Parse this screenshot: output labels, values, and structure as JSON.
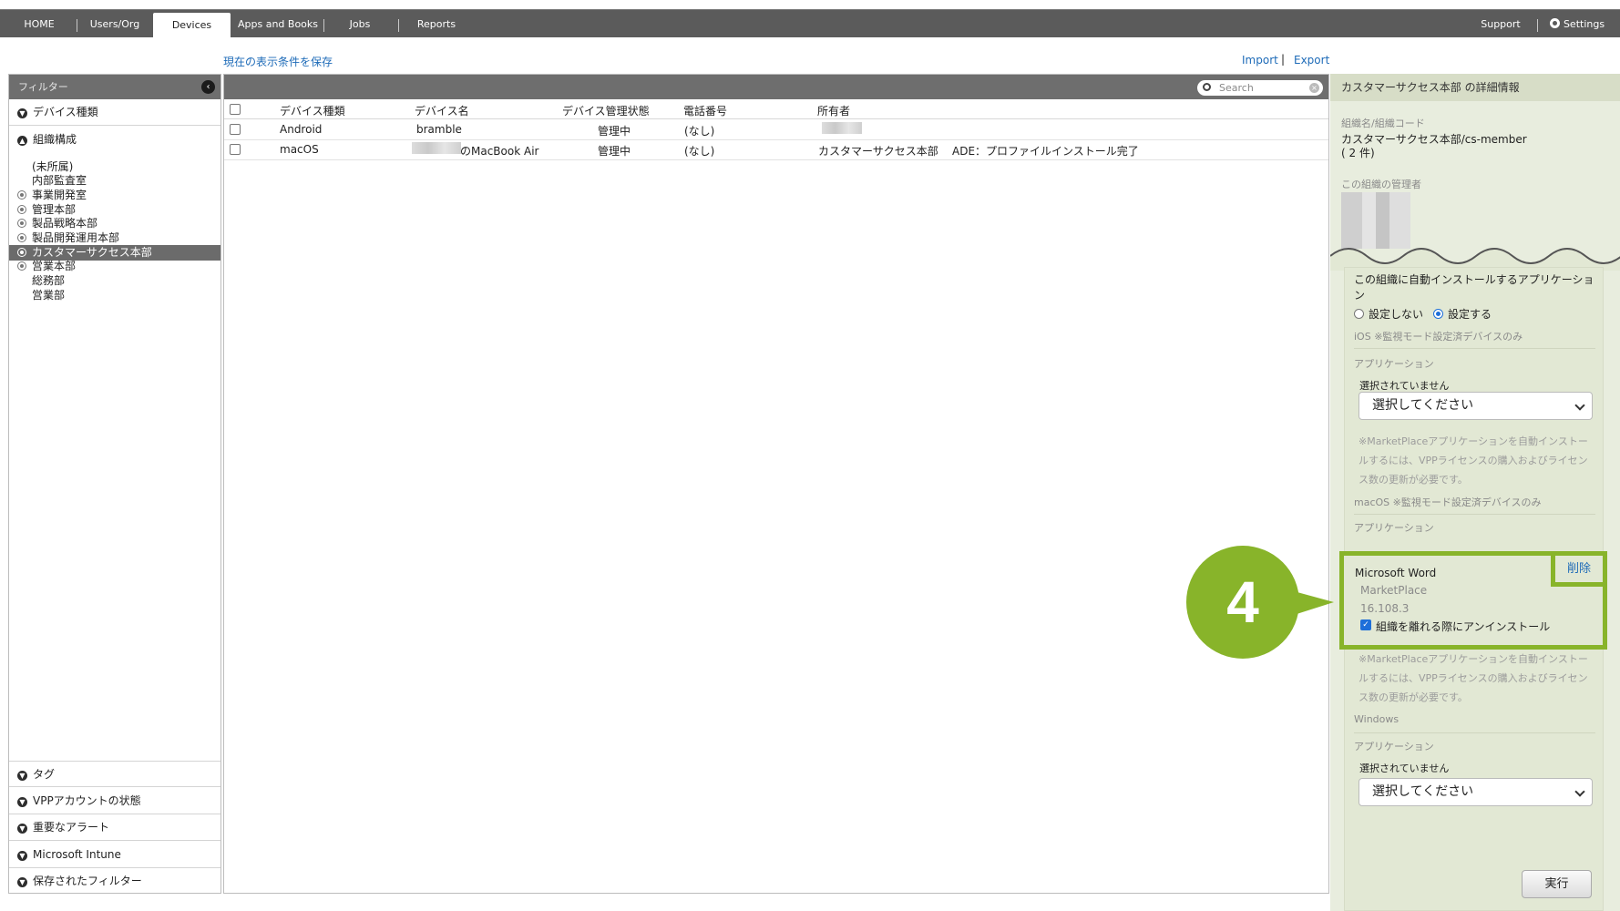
{
  "nav": {
    "tabs": [
      "HOME",
      "Users/Org",
      "Devices",
      "Apps and Books",
      "Jobs",
      "Reports"
    ],
    "support": "Support",
    "settings": "Settings"
  },
  "links": {
    "save_view": "現在の表示条件を保存",
    "import": "Import",
    "separator": "|",
    "export": "Export"
  },
  "sidebar": {
    "header": "フィルター",
    "sections_top": [
      "デバイス種類",
      "組織構成"
    ],
    "tree": [
      "(未所属)",
      "内部監査室",
      "事業開発室",
      "管理本部",
      "製品戦略本部",
      "製品開発運用本部",
      "カスタマーサクセス本部",
      "営業本部",
      "総務部",
      "営業部"
    ],
    "sections_bottom": [
      "タグ",
      "VPPアカウントの状態",
      "重要なアラート",
      "Microsoft Intune",
      "保存されたフィルター"
    ]
  },
  "search": {
    "placeholder": "Search"
  },
  "table": {
    "columns": [
      "デバイス種類",
      "デバイス名",
      "デバイス管理状態",
      "電話番号",
      "所有者"
    ],
    "rows": [
      {
        "type": "Android",
        "name": "bramble",
        "status": "管理中",
        "phone": "(なし)",
        "owner": "",
        "note": ""
      },
      {
        "type": "macOS",
        "name": "のMacBook Air",
        "status": "管理中",
        "phone": "(なし)",
        "owner": "カスタマーサクセス本部",
        "note": "ADE：プロファイルインストール完了"
      }
    ]
  },
  "detail": {
    "title": "カスタマーサクセス本部 の詳細情報",
    "org_label": "組織名/組織コード",
    "org_value": "カスタマーサクセス本部/cs-member",
    "org_count": "( 2 件)",
    "admin_label": "この組織の管理者",
    "auto_install_title": "この組織に自動インストールするアプリケーション",
    "radio_off": "設定しない",
    "radio_on": "設定する",
    "ios_label": "iOS ※監視モード設定済デバイスのみ",
    "app_label": "アプリケーション",
    "not_selected": "選択されていません",
    "select_placeholder": "選択してください",
    "note": "※MarketPlaceアプリケーションを自動インストールするには、VPPライセンスの購入およびライセンス数の更新が必要です。",
    "macos_label": "macOS ※監視モード設定済デバイスのみ",
    "app_name": "Microsoft Word",
    "app_source": "MarketPlace",
    "app_version": "16.108.3",
    "uninstall_label": "組織を離れる際にアンインストール",
    "delete": "削除",
    "windows_label": "Windows",
    "execute": "実行"
  },
  "callout": {
    "number": "4",
    "color": "#88b42a"
  }
}
